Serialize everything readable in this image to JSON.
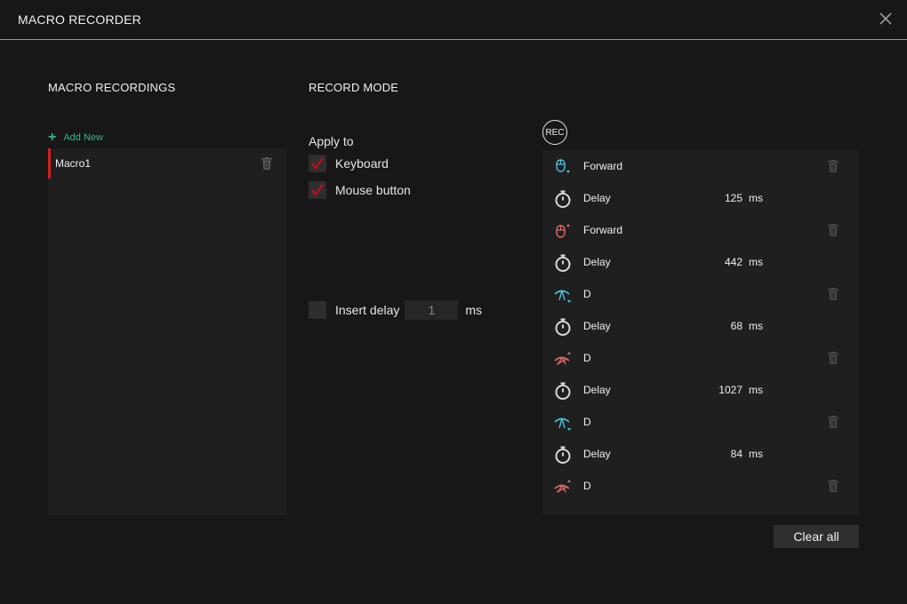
{
  "window": {
    "title": "MACRO RECORDER",
    "close_icon": "close-icon"
  },
  "recordings": {
    "heading": "MACRO RECORDINGS",
    "add_new_label": "Add New",
    "accent_color": "#2fb58a",
    "selected_color": "#d21f26",
    "items": [
      {
        "name": "Macro1"
      }
    ]
  },
  "record_mode": {
    "heading": "RECORD MODE",
    "apply_to_label": "Apply to",
    "keyboard": {
      "label": "Keyboard",
      "checked": true
    },
    "mouse_button": {
      "label": "Mouse button",
      "checked": true
    },
    "insert_delay": {
      "label": "Insert delay",
      "checked": false,
      "value": "1",
      "unit": "ms"
    }
  },
  "recorder": {
    "rec_label": "REC",
    "events": [
      {
        "type": "mouse-down",
        "icon": "mouse-button-down-icon",
        "name": "Forward",
        "value": "",
        "unit": "",
        "deletable": true
      },
      {
        "type": "delay",
        "icon": "stopwatch-icon",
        "name": "Delay",
        "value": "125",
        "unit": "ms",
        "deletable": false
      },
      {
        "type": "mouse-up",
        "icon": "mouse-button-up-icon",
        "name": "Forward",
        "value": "",
        "unit": "",
        "deletable": true
      },
      {
        "type": "delay",
        "icon": "stopwatch-icon",
        "name": "Delay",
        "value": "442",
        "unit": "ms",
        "deletable": false
      },
      {
        "type": "key-down",
        "icon": "key-down-icon",
        "name": "D",
        "value": "",
        "unit": "",
        "deletable": true
      },
      {
        "type": "delay",
        "icon": "stopwatch-icon",
        "name": "Delay",
        "value": "68",
        "unit": "ms",
        "deletable": false
      },
      {
        "type": "key-up",
        "icon": "key-up-icon",
        "name": "D",
        "value": "",
        "unit": "",
        "deletable": true
      },
      {
        "type": "delay",
        "icon": "stopwatch-icon",
        "name": "Delay",
        "value": "1027",
        "unit": "ms",
        "deletable": false
      },
      {
        "type": "key-down",
        "icon": "key-down-icon",
        "name": "D",
        "value": "",
        "unit": "",
        "deletable": true
      },
      {
        "type": "delay",
        "icon": "stopwatch-icon",
        "name": "Delay",
        "value": "84",
        "unit": "ms",
        "deletable": false
      },
      {
        "type": "key-up",
        "icon": "key-up-icon",
        "name": "D",
        "value": "",
        "unit": "",
        "deletable": true
      }
    ],
    "down_color": "#4fc3e0",
    "up_color": "#e06a6a",
    "clear_all_label": "Clear all"
  }
}
